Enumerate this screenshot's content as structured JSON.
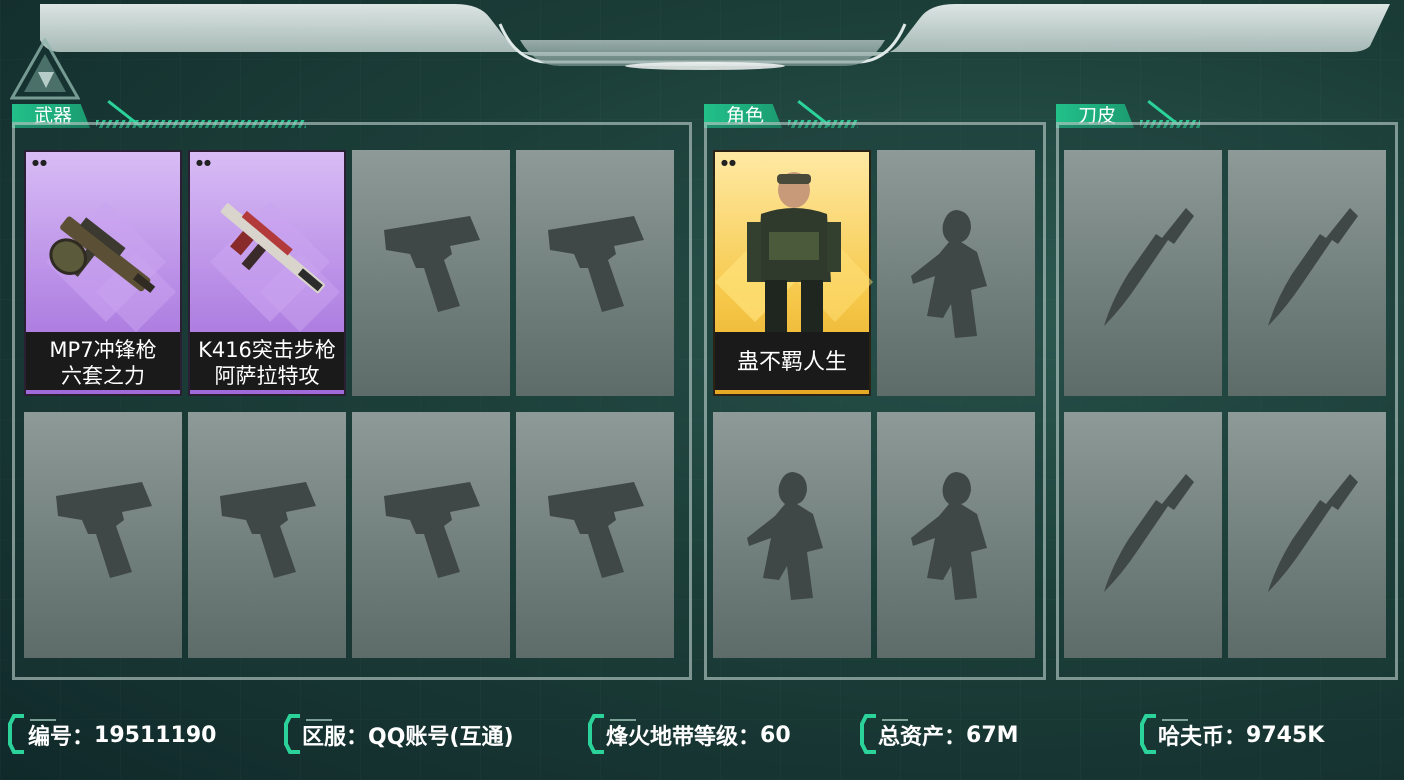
{
  "sections": {
    "weapons": {
      "title": "武器"
    },
    "characters": {
      "title": "角色"
    },
    "knives": {
      "title": "刀皮"
    }
  },
  "weapon_items": [
    {
      "line1": "MP7冲锋枪",
      "line2": "六套之力",
      "rarity_color": "#b88de6"
    },
    {
      "line1": "K416突击步枪",
      "line2": "阿萨拉特攻",
      "rarity_color": "#b88de6"
    }
  ],
  "character_items": [
    {
      "name": "蛊不羁人生",
      "rarity_color": "#f6c84a"
    }
  ],
  "footer": {
    "id_label": "编号：",
    "id_value": "19511190",
    "server_label": "区服：",
    "server_value": "QQ账号(互通)",
    "level_label": "烽火地带等级：",
    "level_value": "60",
    "assets_label": "总资产：",
    "assets_value": "67M",
    "coin_label": "哈夫币：",
    "coin_value": "9745K"
  },
  "colors": {
    "accent": "#22c08a",
    "purple": "#b88de6",
    "gold": "#f6c84a"
  }
}
